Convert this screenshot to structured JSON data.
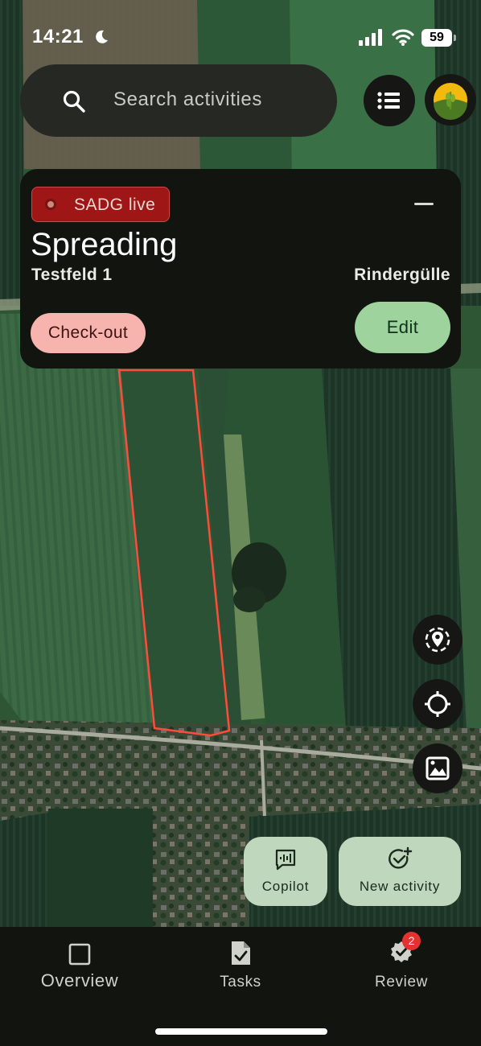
{
  "status_bar": {
    "time": "14:21",
    "battery": "59",
    "icons": [
      "moon-icon",
      "signal-icon",
      "wifi-icon",
      "battery-icon"
    ]
  },
  "search": {
    "placeholder": "Search activities",
    "icon": "search-icon"
  },
  "header_buttons": {
    "list": "list-icon",
    "avatar": "avatar"
  },
  "activity_card": {
    "live_label": "SADG live",
    "title": "Spreading",
    "field": "Testfeld 1",
    "product": "Rindergülle",
    "checkout_label": "Check-out",
    "edit_label": "Edit",
    "minimize": "minimize-icon"
  },
  "map": {
    "field_outline_color": "#ff4b3a",
    "controls": [
      "location-settings-icon",
      "my-location-icon",
      "map-layer-icon"
    ]
  },
  "fabs": {
    "copilot_label": "Copilot",
    "new_activity_label": "New activity"
  },
  "bottom_nav": {
    "items": [
      {
        "label": "Overview",
        "icon": "overview-icon"
      },
      {
        "label": "Tasks",
        "icon": "tasks-icon"
      },
      {
        "label": "Review",
        "icon": "review-icon",
        "badge": "2"
      }
    ]
  },
  "colors": {
    "live_badge": "#9e1616",
    "checkout": "#f7b3ad",
    "edit": "#9ed39e",
    "fab": "#bfd7bd",
    "notification_badge": "#e3322f"
  }
}
